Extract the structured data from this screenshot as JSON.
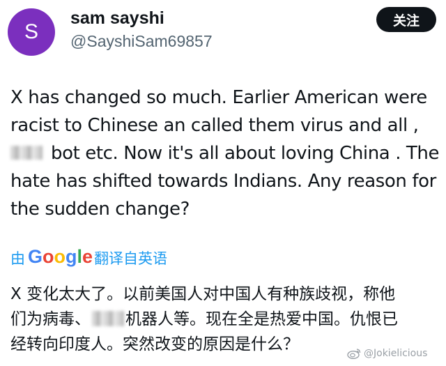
{
  "user": {
    "avatar_letter": "S",
    "avatar_color": "#7b2fbe",
    "display_name": "sam sayshi",
    "handle": "@SayshiSam69857"
  },
  "follow_button_label": "关注",
  "tweet": {
    "line1": "X has changed so much. Earlier American were",
    "line2": "racist to Chinese an called them virus and all ,",
    "line3_after_redaction": "bot etc. Now it's all about loving China . The",
    "line4": "hate has shifted towards Indians. Any reason for",
    "line5": "the sudden change?"
  },
  "translate": {
    "prefix": "由",
    "brand": "Google",
    "suffix": "翻译自英语",
    "link_color": "#1d9bf0"
  },
  "translated": {
    "line1": "X 变化太大了。以前美国人对中国人有种族歧视，称他",
    "line2_before_redaction": "们为病毒、",
    "line2_after_redaction": "机器人等。现在全是热爱中国。仇恨已",
    "line3": "经转向印度人。突然改变的原因是什么？"
  },
  "watermark": {
    "icon": "weibo-icon",
    "text": "@Jokielicious"
  }
}
